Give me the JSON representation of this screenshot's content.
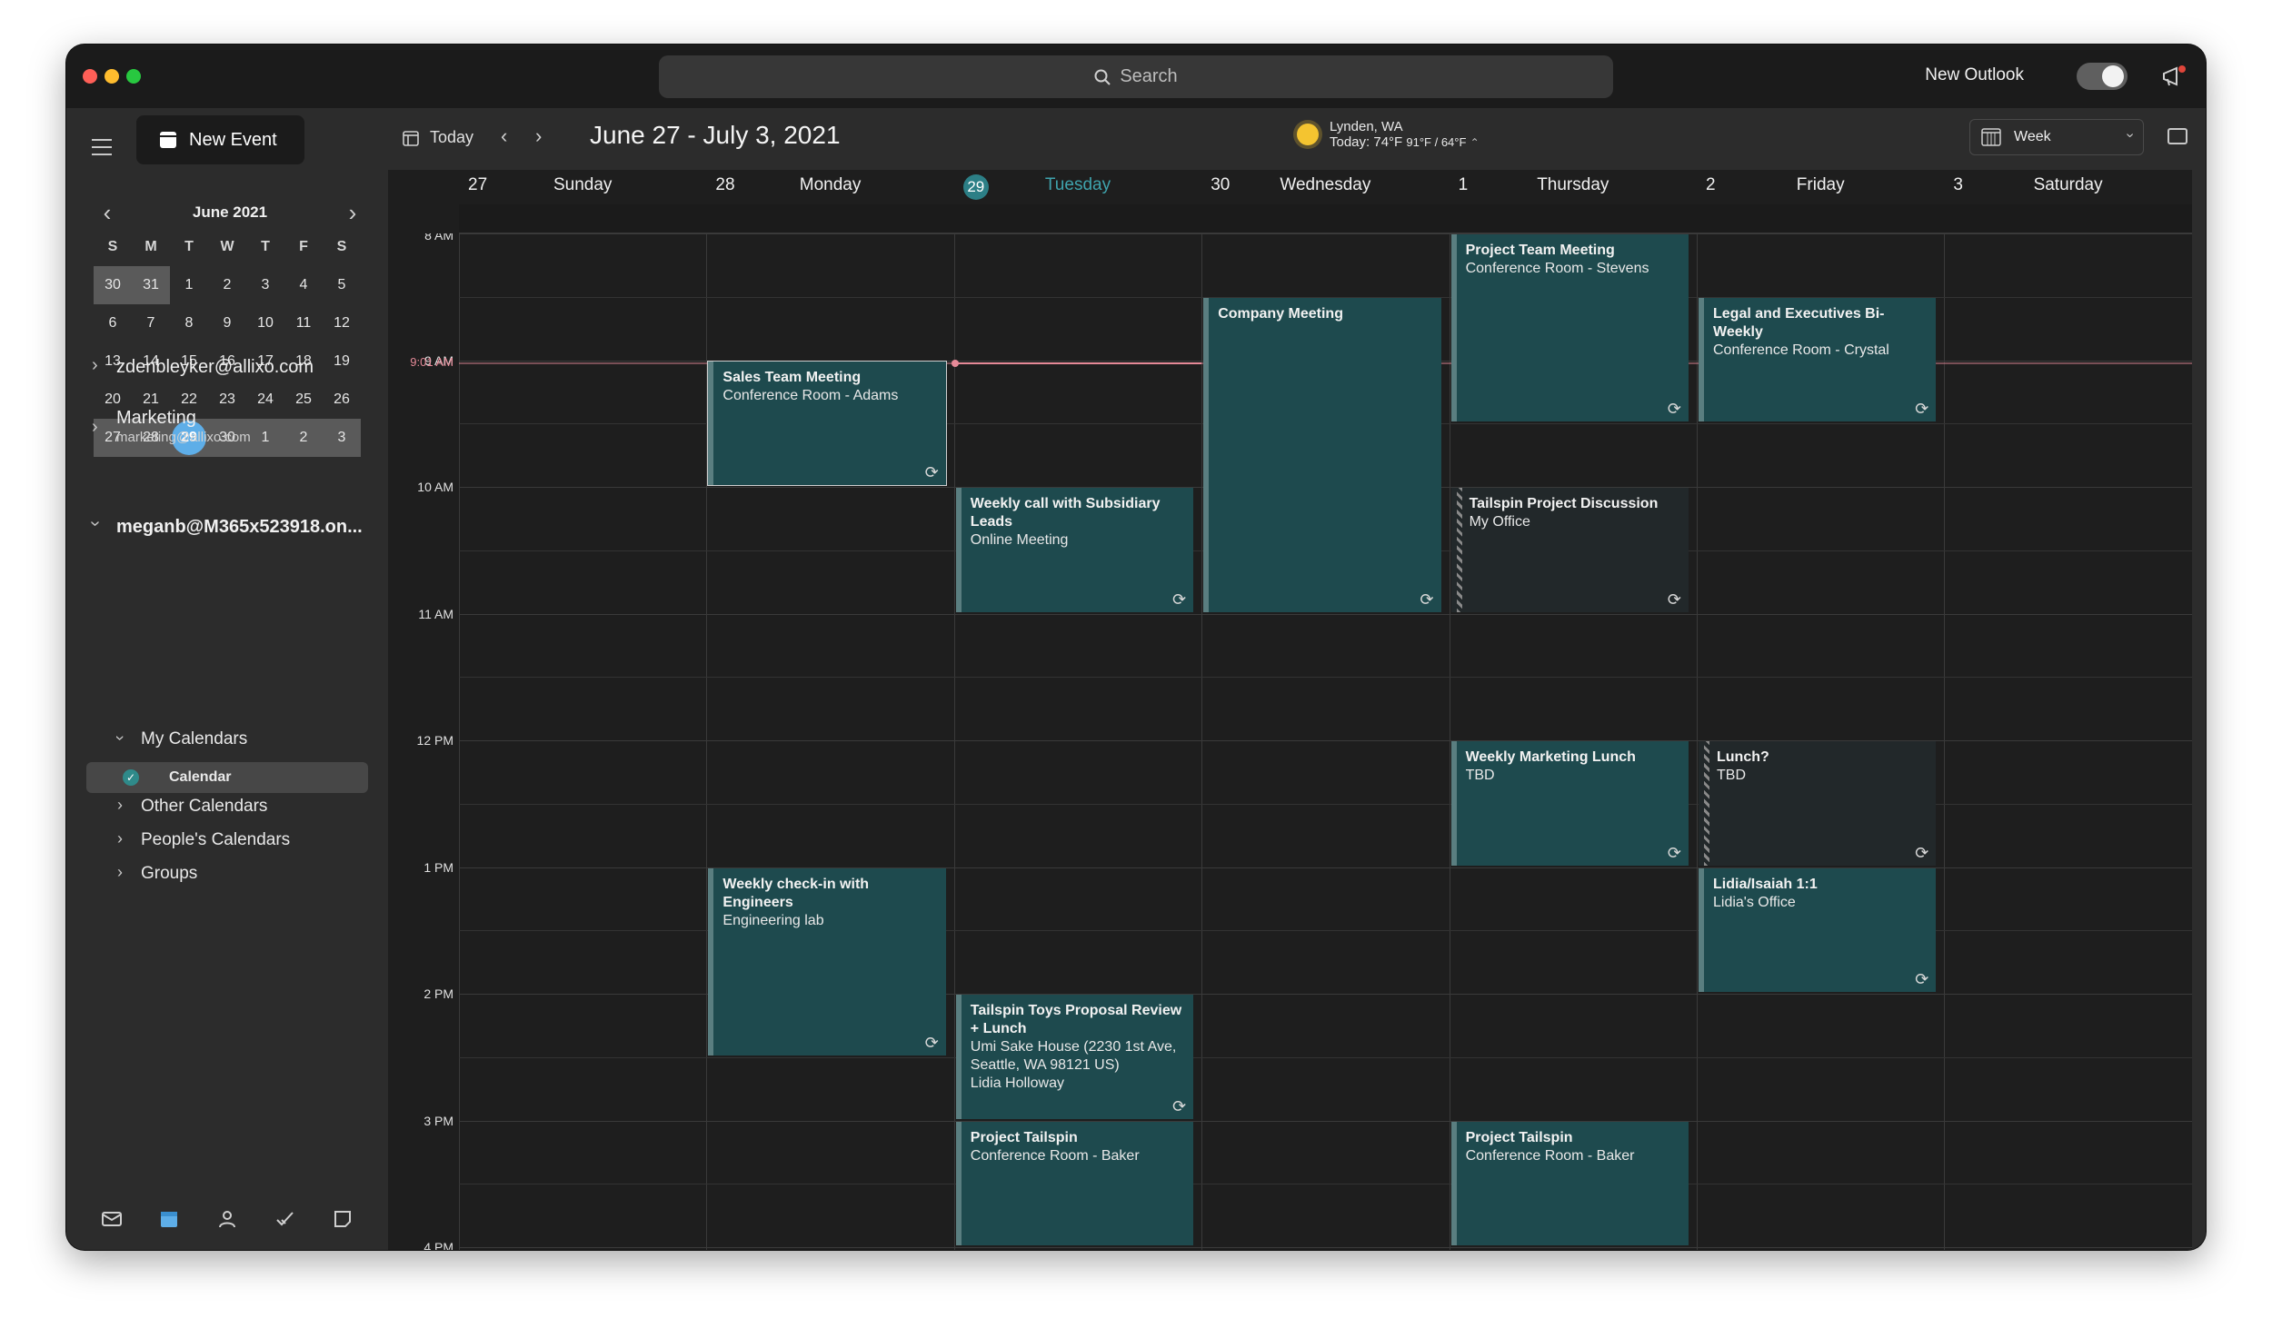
{
  "window": {
    "search_placeholder": "Search",
    "new_outlook_label": "New Outlook",
    "new_outlook_enabled": true
  },
  "sidebar": {
    "new_event_label": "New Event",
    "mini_calendar": {
      "month_label": "June 2021",
      "weekday_headers": [
        "S",
        "M",
        "T",
        "W",
        "T",
        "F",
        "S"
      ],
      "weeks": [
        [
          "30",
          "31",
          "1",
          "2",
          "3",
          "4",
          "5"
        ],
        [
          "6",
          "7",
          "8",
          "9",
          "10",
          "11",
          "12"
        ],
        [
          "13",
          "14",
          "15",
          "16",
          "17",
          "18",
          "19"
        ],
        [
          "20",
          "21",
          "22",
          "23",
          "24",
          "25",
          "26"
        ],
        [
          "27",
          "28",
          "29",
          "30",
          "1",
          "2",
          "3"
        ]
      ],
      "today": "29"
    },
    "accounts": [
      {
        "name": "zdenbleyker@allixo.com",
        "expanded": false
      },
      {
        "name": "Marketing",
        "email": "marketing@allixo.com",
        "expanded": false
      },
      {
        "name": "meganb@M365x523918.on...",
        "expanded": true
      }
    ],
    "tree": {
      "my_calendars": "My Calendars",
      "calendar": "Calendar",
      "other_calendars": "Other Calendars",
      "peoples_calendars": "People's Calendars",
      "groups": "Groups"
    },
    "bottom_icons": [
      "mail-icon",
      "calendar-icon",
      "people-icon",
      "tasks-icon",
      "notes-icon"
    ]
  },
  "toolbar": {
    "today_label": "Today",
    "date_range": "June 27 - July 3, 2021",
    "weather_location": "Lynden, WA",
    "weather_today": "Today: 74°F",
    "weather_range": "91°F / 64°F",
    "view_label": "Week"
  },
  "days": [
    {
      "num": "27",
      "name": "Sunday",
      "today": false
    },
    {
      "num": "28",
      "name": "Monday",
      "today": false
    },
    {
      "num": "29",
      "name": "Tuesday",
      "today": true
    },
    {
      "num": "30",
      "name": "Wednesday",
      "today": false
    },
    {
      "num": "1",
      "name": "Thursday",
      "today": false
    },
    {
      "num": "2",
      "name": "Friday",
      "today": false
    },
    {
      "num": "3",
      "name": "Saturday",
      "today": false
    }
  ],
  "time_labels": [
    "8 AM",
    "9 AM",
    "10 AM",
    "11 AM",
    "12 PM",
    "1 PM",
    "2 PM",
    "3 PM",
    "4 PM"
  ],
  "now_label": "9:01 AM",
  "colors": {
    "event_bg": "#1e4a4e",
    "today_accent": "#2c7f86",
    "now_line": "#e68a98",
    "mini_today": "#5eaee8"
  },
  "events": [
    {
      "day": 1,
      "start": 9.0,
      "end": 10.0,
      "title": "Sales Team Meeting",
      "location": [
        "Conference Room - Adams"
      ],
      "recurring": true,
      "selected": true
    },
    {
      "day": 1,
      "start": 13.0,
      "end": 14.5,
      "title": "Weekly check-in with Engineers",
      "location": [
        "Engineering lab"
      ],
      "recurring": true
    },
    {
      "day": 2,
      "start": 10.0,
      "end": 11.0,
      "title": "Weekly call with Subsidiary Leads",
      "location": [
        "Online Meeting"
      ],
      "recurring": true
    },
    {
      "day": 2,
      "start": 14.0,
      "end": 15.0,
      "title": "Tailspin Toys Proposal Review + Lunch",
      "location": [
        "Umi Sake House (2230 1st Ave, Seattle, WA 98121 US)",
        "Lidia Holloway"
      ],
      "recurring": true
    },
    {
      "day": 2,
      "start": 15.0,
      "end": 16.0,
      "title": "Project Tailspin",
      "location": [
        "Conference Room - Baker"
      ],
      "recurring": false
    },
    {
      "day": 3,
      "start": 8.5,
      "end": 11.0,
      "title": "Company Meeting",
      "location": [],
      "recurring": true
    },
    {
      "day": 4,
      "start": 8.0,
      "end": 9.5,
      "title": "Project Team Meeting",
      "location": [
        "Conference Room - Stevens"
      ],
      "recurring": true
    },
    {
      "day": 4,
      "start": 10.0,
      "end": 11.0,
      "title": "Tailspin Project Discussion",
      "location": [
        "My Office"
      ],
      "recurring": true,
      "tentative": true
    },
    {
      "day": 4,
      "start": 12.0,
      "end": 13.0,
      "title": "Weekly Marketing Lunch",
      "location": [
        "TBD"
      ],
      "recurring": true
    },
    {
      "day": 4,
      "start": 15.0,
      "end": 16.0,
      "title": "Project Tailspin",
      "location": [
        "Conference Room - Baker"
      ],
      "recurring": false
    },
    {
      "day": 5,
      "start": 8.5,
      "end": 9.5,
      "title": "Legal and Executives Bi-Weekly",
      "location": [
        "Conference Room - Crystal"
      ],
      "recurring": true
    },
    {
      "day": 5,
      "start": 12.0,
      "end": 13.0,
      "title": "Lunch?",
      "location": [
        "TBD"
      ],
      "recurring": true,
      "tentative": true
    },
    {
      "day": 5,
      "start": 13.0,
      "end": 14.0,
      "title": "Lidia/Isaiah 1:1",
      "location": [
        "Lidia's Office"
      ],
      "recurring": true
    }
  ]
}
